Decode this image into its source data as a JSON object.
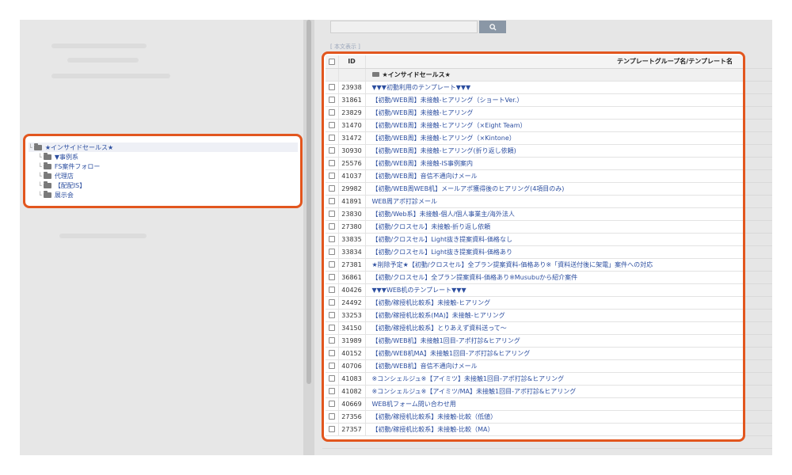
{
  "tree": {
    "root": "★インサイドセールス★",
    "children": [
      "▼事例系",
      "FS案件フォロー",
      "代理店",
      "【配配IS】",
      "展示会"
    ]
  },
  "search": {
    "button_icon": "search-icon",
    "toggle_label": "[ 本文表示 ]"
  },
  "table": {
    "header": {
      "id": "ID",
      "name": "テンプレートグループ名/テンプレート名"
    },
    "group_label": "★インサイドセールス★",
    "rows": [
      {
        "id": "23938",
        "name": "▼▼▼初動利用のテンプレート▼▼▼"
      },
      {
        "id": "31861",
        "name": "【初動/WEB周】未接触-ヒアリング（ショートVer.）"
      },
      {
        "id": "23829",
        "name": "【初動/WEB周】未接触-ヒアリング"
      },
      {
        "id": "31470",
        "name": "【初動/WEB周】未接触-ヒアリング（×Eight Team）"
      },
      {
        "id": "31472",
        "name": "【初動/WEB周】未接触-ヒアリング（×Kintone）"
      },
      {
        "id": "30930",
        "name": "【初動/WEB周】未接触-ヒアリング(折り返し依頼)"
      },
      {
        "id": "25576",
        "name": "【初動/WEB周】未接触-IS事例案内"
      },
      {
        "id": "41037",
        "name": "【初動/WEB周】音信不通向けメール"
      },
      {
        "id": "29982",
        "name": "【初動/WEB周WEB机】メールアポ獲得後のヒアリング(4項目のみ)"
      },
      {
        "id": "41891",
        "name": "WEB周アポ打診メール"
      },
      {
        "id": "23830",
        "name": "【初動/Web系】未接触-個人/個人事業主/海外法人"
      },
      {
        "id": "27380",
        "name": "【初動/クロスセル】未接触-折り返し依頼"
      },
      {
        "id": "33835",
        "name": "【初動/クロスセル】Light抜き提案資料-価格なし"
      },
      {
        "id": "33834",
        "name": "【初動/クロスセル】Light抜き提案資料-価格あり"
      },
      {
        "id": "27381",
        "name": "★削除予定★【初動/クロスセル】全プラン提案資料-価格あり※「資料送付後に架電」案件への対応"
      },
      {
        "id": "36861",
        "name": "【初動/クロスセル】全プラン提案資料-価格あり※Musubuから紹介案件"
      },
      {
        "id": "40426",
        "name": "▼▼▼WEB机のテンプレート▼▼▼"
      },
      {
        "id": "24492",
        "name": "【初動/稼授机比較系】未接触-ヒアリング"
      },
      {
        "id": "33253",
        "name": "【初動/稼授机比較系(MA)】未接触-ヒアリング"
      },
      {
        "id": "34150",
        "name": "【初動/稼授机比較系】とりあえず資料送って～"
      },
      {
        "id": "31989",
        "name": "【初動/WEB机】未接触1回目-アポ打診&ヒアリング"
      },
      {
        "id": "40152",
        "name": "【初動/WEB机MA】未接触1回目-アポ打診&ヒアリング"
      },
      {
        "id": "40706",
        "name": "【初動/WEB机】音信不通向けメール"
      },
      {
        "id": "41083",
        "name": "※コンシェルジュ※【アイミツ】未接触1回目-アポ打診&ヒアリング"
      },
      {
        "id": "41082",
        "name": "※コンシェルジュ※【アイミツ/MA】未接触1回目-アポ打診&ヒアリング"
      },
      {
        "id": "40669",
        "name": "WEB机フォーム問い合わせ用"
      },
      {
        "id": "27356",
        "name": "【初動/稼授机比較系】未接触-比較（低値）"
      },
      {
        "id": "27357",
        "name": "【初動/稼授机比較系】未接触-比較（MA）"
      }
    ]
  },
  "colors": {
    "highlight": "#e2561e",
    "link": "#2d4fa0"
  }
}
